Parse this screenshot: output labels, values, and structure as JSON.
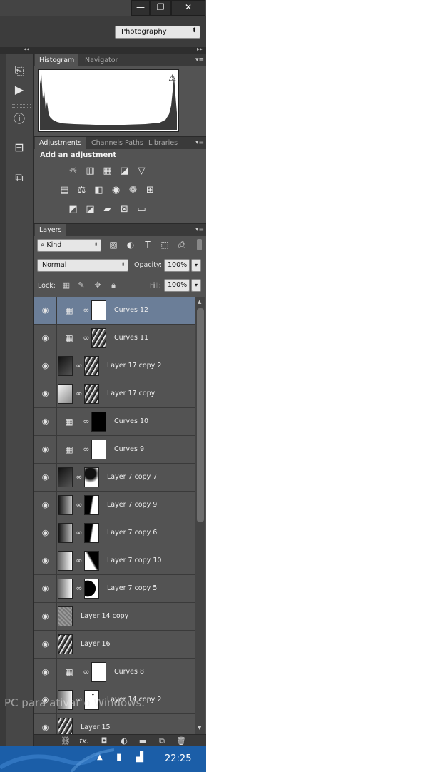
{
  "window": {
    "minimize_glyph": "—",
    "restore_glyph": "❐",
    "close_glyph": "✕"
  },
  "workspace": {
    "selected": "Photography"
  },
  "dock": {
    "collapse_left": "◂◂",
    "collapse_right": "▸▸",
    "icons": [
      "history-icon",
      "actions-play-icon",
      "info-icon",
      "properties-icon",
      "layer-comps-icon"
    ]
  },
  "histogram_panel": {
    "tabs": [
      "Histogram",
      "Navigator"
    ],
    "active_tab": "Histogram",
    "warning_glyph": "⚠"
  },
  "adjustments_panel": {
    "tabs": [
      "Adjustments",
      "Channels",
      "Paths",
      "Libraries"
    ],
    "heading": "Add an adjustment"
  },
  "layers_panel": {
    "tab": "Layers",
    "filter_kind": "Kind",
    "blend_mode": "Normal",
    "opacity_label": "Opacity:",
    "opacity_value": "100%",
    "lock_label": "Lock:",
    "fill_label": "Fill:",
    "fill_value": "100%",
    "layers": [
      {
        "name": "Curves 12",
        "type": "adjustment",
        "mask": "white",
        "selected": true
      },
      {
        "name": "Curves 11",
        "type": "adjustment",
        "mask": "texture"
      },
      {
        "name": "Layer 17 copy 2",
        "type": "image",
        "thumb": "dark",
        "mask": "texture"
      },
      {
        "name": "Layer 17 copy",
        "type": "image",
        "thumb": "light",
        "mask": "texture"
      },
      {
        "name": "Curves 10",
        "type": "adjustment",
        "mask": "black"
      },
      {
        "name": "Curves 9",
        "type": "adjustment",
        "mask": "white"
      },
      {
        "name": "Layer 7 copy 7",
        "type": "image",
        "thumb": "dark",
        "mask": "blob"
      },
      {
        "name": "Layer 7 copy 9",
        "type": "image",
        "thumb": "darkgrad",
        "mask": "curve"
      },
      {
        "name": "Layer 7 copy 6",
        "type": "image",
        "thumb": "darkgrad",
        "mask": "curve"
      },
      {
        "name": "Layer 7 copy 10",
        "type": "image",
        "thumb": "lightgrad",
        "mask": "wedge"
      },
      {
        "name": "Layer 7 copy 5",
        "type": "image",
        "thumb": "lightgrad",
        "mask": "halfmoon"
      },
      {
        "name": "Layer 14 copy",
        "type": "plain",
        "thumb": "noise"
      },
      {
        "name": "Layer 16",
        "type": "plain",
        "thumb": "texture"
      },
      {
        "name": "Curves 8",
        "type": "adjustment",
        "mask": "white"
      },
      {
        "name": "Layer 14 copy 2",
        "type": "image",
        "thumb": "lightgrad",
        "mask": "speck"
      },
      {
        "name": "Layer 15",
        "type": "plain",
        "thumb": "texture"
      }
    ]
  },
  "bottom_buttons": [
    "link-layers-icon",
    "fx-icon",
    "add-mask-icon",
    "new-adjustment-icon",
    "new-group-icon",
    "new-layer-icon",
    "delete-icon"
  ],
  "fx_text": "fx.",
  "watermark": "PC para ativar o Windows.",
  "taskbar": {
    "clock": "22:25"
  }
}
